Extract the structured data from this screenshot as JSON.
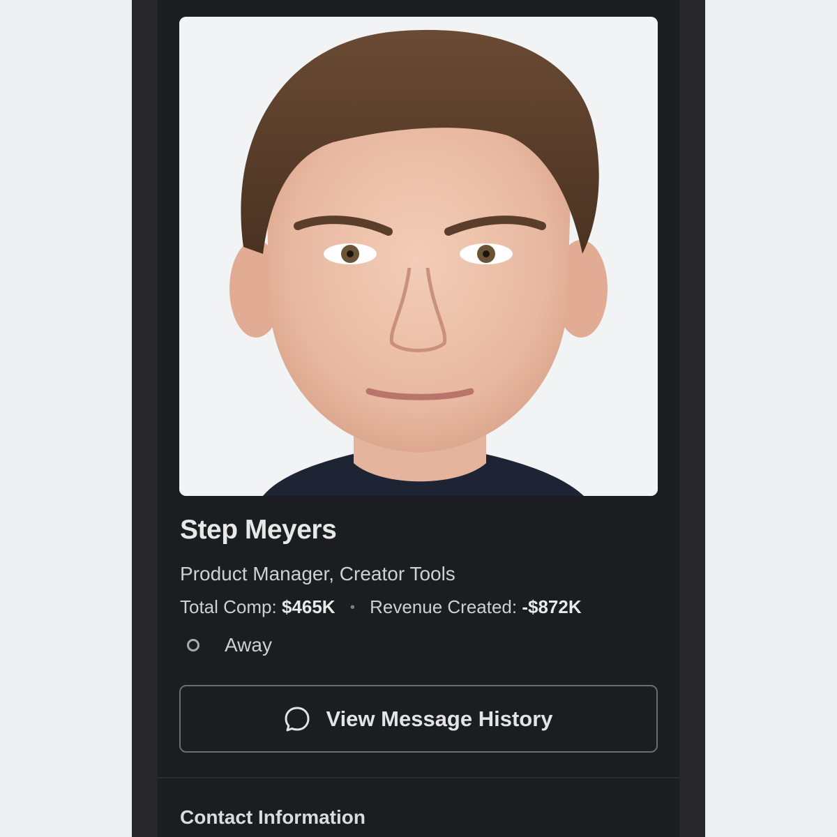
{
  "profile": {
    "photo_alt": "Profile photo of Step Meyers",
    "name": "Step Meyers",
    "title": "Product Manager, Creator Tools",
    "comp_label": "Total Comp:",
    "comp_value": "$465K",
    "separator": "•",
    "revenue_label": "Revenue Created:",
    "revenue_value": "-$872K",
    "status": "Away"
  },
  "actions": {
    "message_history_label": "View Message History",
    "message_icon": "message-bubble-icon"
  },
  "sections": {
    "contact_heading": "Contact Information"
  },
  "colors": {
    "background": "#1b1d21",
    "text": "#cfd0d2",
    "button_border": "#6b6d72"
  }
}
